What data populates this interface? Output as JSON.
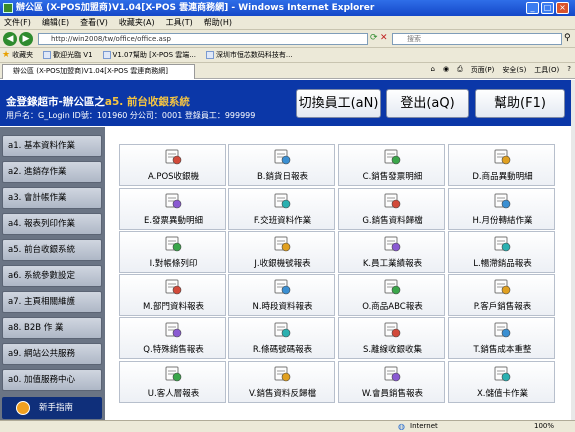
{
  "window": {
    "title": "辦公區 (X-POS加盟商)V1.04[X-POS 雲連商務網] - Windows Internet Explorer"
  },
  "menu": [
    "文件(F)",
    "编辑(E)",
    "查看(V)",
    "收藏夹(A)",
    "工具(T)",
    "帮助(H)"
  ],
  "address": {
    "url": "http://win2008/tw/office/office.asp",
    "search_placeholder": "搜索"
  },
  "favorites": {
    "label": "收藏夹",
    "items": [
      "歡迎光臨 V1",
      "V1.07幫助 [X-POS 雲端...",
      "深圳市恒芯数码科技有..."
    ]
  },
  "tab": {
    "title": "辦公區 (X-POS加盟商)V1.04[X-POS 雲連商務網]",
    "tools": [
      "页面(P)",
      "安全(S)",
      "工具(O)"
    ]
  },
  "header": {
    "shop_prefix": "金登錄超市-辦公區之",
    "shop_suffix": "a5. 前台收銀系統",
    "user_line": "用戶名：G_Login ID號：101960 分公司：0001  登錄員工：999999",
    "buttons": [
      "切換員工(aN)",
      "登出(aQ)",
      "幫助(F1)"
    ]
  },
  "sidebar": {
    "items": [
      "a1. 基本資料作業",
      "a2. 進銷存作業",
      "a3. 會計帳作業",
      "a4. 報表列印作業",
      "a5. 前台收銀系統",
      "a6. 系統參數設定",
      "a7. 主頁相關維護",
      "a8. B2B 作 業",
      "a9. 網站公共服務",
      "a0. 加值服務中心"
    ],
    "guide": "新手指南"
  },
  "grid": {
    "items": [
      {
        "label": "A.POS收銀機",
        "icon": "pos-terminal-icon"
      },
      {
        "label": "B.銷貨日報表",
        "icon": "daily-report-icon"
      },
      {
        "label": "C.銷售發票明細",
        "icon": "invoice-icon"
      },
      {
        "label": "D.商品異動明細",
        "icon": "product-change-icon"
      },
      {
        "label": "E.發票異動明細",
        "icon": "invoice-change-icon"
      },
      {
        "label": "F.交班資料作業",
        "icon": "shift-handover-icon"
      },
      {
        "label": "G.銷售資料歸檔",
        "icon": "sales-archive-icon"
      },
      {
        "label": "H.月份轉結作業",
        "icon": "month-close-icon"
      },
      {
        "label": "I.對帳條列印",
        "icon": "printer-icon"
      },
      {
        "label": "J.收銀機號報表",
        "icon": "register-report-icon"
      },
      {
        "label": "K.員工業績報表",
        "icon": "staff-performance-icon"
      },
      {
        "label": "L.暢滯銷品報表",
        "icon": "bestseller-icon"
      },
      {
        "label": "M.部門資料報表",
        "icon": "department-report-icon"
      },
      {
        "label": "N.時段資料報表",
        "icon": "time-slot-icon"
      },
      {
        "label": "O.商品ABC報表",
        "icon": "abc-report-icon"
      },
      {
        "label": "P.客戶銷售報表",
        "icon": "customer-sales-icon"
      },
      {
        "label": "Q.特殊銷售報表",
        "icon": "special-sales-icon"
      },
      {
        "label": "R.條碼號碼報表",
        "icon": "barcode-report-icon"
      },
      {
        "label": "S.離線收銀收集",
        "icon": "offline-collect-icon"
      },
      {
        "label": "T.銷售成本重整",
        "icon": "cost-rebuild-icon"
      },
      {
        "label": "U.客人層報表",
        "icon": "customer-level-icon"
      },
      {
        "label": "V.銷售資料反歸檔",
        "icon": "unarchive-icon"
      },
      {
        "label": "W.會員銷售報表",
        "icon": "member-sales-icon"
      },
      {
        "label": "X.儲值卡作業",
        "icon": "stored-card-icon"
      }
    ]
  },
  "status": {
    "zone": "Internet",
    "zoom": "100%"
  },
  "colors": {
    "header_bg": "#0b37a8",
    "accent_text": "#f5c542",
    "sidebar_bg": "#6a7484"
  }
}
